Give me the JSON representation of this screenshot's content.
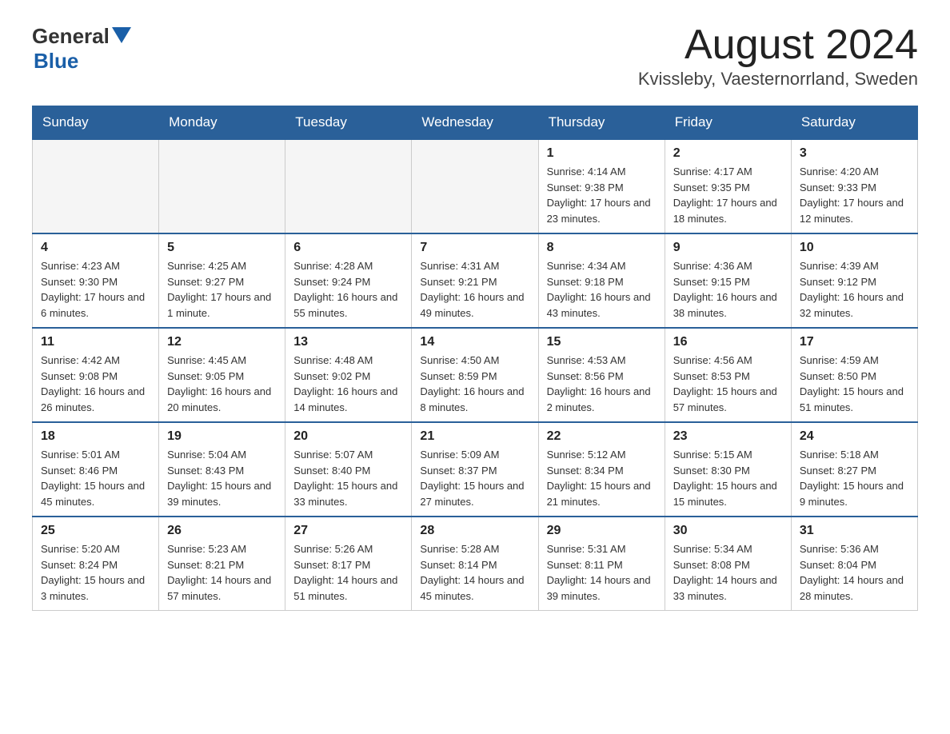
{
  "header": {
    "logo_general": "General",
    "logo_blue": "Blue",
    "month_title": "August 2024",
    "location": "Kvissleby, Vaesternorrland, Sweden"
  },
  "calendar": {
    "days_of_week": [
      "Sunday",
      "Monday",
      "Tuesday",
      "Wednesday",
      "Thursday",
      "Friday",
      "Saturday"
    ],
    "weeks": [
      [
        {
          "day": "",
          "info": ""
        },
        {
          "day": "",
          "info": ""
        },
        {
          "day": "",
          "info": ""
        },
        {
          "day": "",
          "info": ""
        },
        {
          "day": "1",
          "info": "Sunrise: 4:14 AM\nSunset: 9:38 PM\nDaylight: 17 hours and 23 minutes."
        },
        {
          "day": "2",
          "info": "Sunrise: 4:17 AM\nSunset: 9:35 PM\nDaylight: 17 hours and 18 minutes."
        },
        {
          "day": "3",
          "info": "Sunrise: 4:20 AM\nSunset: 9:33 PM\nDaylight: 17 hours and 12 minutes."
        }
      ],
      [
        {
          "day": "4",
          "info": "Sunrise: 4:23 AM\nSunset: 9:30 PM\nDaylight: 17 hours and 6 minutes."
        },
        {
          "day": "5",
          "info": "Sunrise: 4:25 AM\nSunset: 9:27 PM\nDaylight: 17 hours and 1 minute."
        },
        {
          "day": "6",
          "info": "Sunrise: 4:28 AM\nSunset: 9:24 PM\nDaylight: 16 hours and 55 minutes."
        },
        {
          "day": "7",
          "info": "Sunrise: 4:31 AM\nSunset: 9:21 PM\nDaylight: 16 hours and 49 minutes."
        },
        {
          "day": "8",
          "info": "Sunrise: 4:34 AM\nSunset: 9:18 PM\nDaylight: 16 hours and 43 minutes."
        },
        {
          "day": "9",
          "info": "Sunrise: 4:36 AM\nSunset: 9:15 PM\nDaylight: 16 hours and 38 minutes."
        },
        {
          "day": "10",
          "info": "Sunrise: 4:39 AM\nSunset: 9:12 PM\nDaylight: 16 hours and 32 minutes."
        }
      ],
      [
        {
          "day": "11",
          "info": "Sunrise: 4:42 AM\nSunset: 9:08 PM\nDaylight: 16 hours and 26 minutes."
        },
        {
          "day": "12",
          "info": "Sunrise: 4:45 AM\nSunset: 9:05 PM\nDaylight: 16 hours and 20 minutes."
        },
        {
          "day": "13",
          "info": "Sunrise: 4:48 AM\nSunset: 9:02 PM\nDaylight: 16 hours and 14 minutes."
        },
        {
          "day": "14",
          "info": "Sunrise: 4:50 AM\nSunset: 8:59 PM\nDaylight: 16 hours and 8 minutes."
        },
        {
          "day": "15",
          "info": "Sunrise: 4:53 AM\nSunset: 8:56 PM\nDaylight: 16 hours and 2 minutes."
        },
        {
          "day": "16",
          "info": "Sunrise: 4:56 AM\nSunset: 8:53 PM\nDaylight: 15 hours and 57 minutes."
        },
        {
          "day": "17",
          "info": "Sunrise: 4:59 AM\nSunset: 8:50 PM\nDaylight: 15 hours and 51 minutes."
        }
      ],
      [
        {
          "day": "18",
          "info": "Sunrise: 5:01 AM\nSunset: 8:46 PM\nDaylight: 15 hours and 45 minutes."
        },
        {
          "day": "19",
          "info": "Sunrise: 5:04 AM\nSunset: 8:43 PM\nDaylight: 15 hours and 39 minutes."
        },
        {
          "day": "20",
          "info": "Sunrise: 5:07 AM\nSunset: 8:40 PM\nDaylight: 15 hours and 33 minutes."
        },
        {
          "day": "21",
          "info": "Sunrise: 5:09 AM\nSunset: 8:37 PM\nDaylight: 15 hours and 27 minutes."
        },
        {
          "day": "22",
          "info": "Sunrise: 5:12 AM\nSunset: 8:34 PM\nDaylight: 15 hours and 21 minutes."
        },
        {
          "day": "23",
          "info": "Sunrise: 5:15 AM\nSunset: 8:30 PM\nDaylight: 15 hours and 15 minutes."
        },
        {
          "day": "24",
          "info": "Sunrise: 5:18 AM\nSunset: 8:27 PM\nDaylight: 15 hours and 9 minutes."
        }
      ],
      [
        {
          "day": "25",
          "info": "Sunrise: 5:20 AM\nSunset: 8:24 PM\nDaylight: 15 hours and 3 minutes."
        },
        {
          "day": "26",
          "info": "Sunrise: 5:23 AM\nSunset: 8:21 PM\nDaylight: 14 hours and 57 minutes."
        },
        {
          "day": "27",
          "info": "Sunrise: 5:26 AM\nSunset: 8:17 PM\nDaylight: 14 hours and 51 minutes."
        },
        {
          "day": "28",
          "info": "Sunrise: 5:28 AM\nSunset: 8:14 PM\nDaylight: 14 hours and 45 minutes."
        },
        {
          "day": "29",
          "info": "Sunrise: 5:31 AM\nSunset: 8:11 PM\nDaylight: 14 hours and 39 minutes."
        },
        {
          "day": "30",
          "info": "Sunrise: 5:34 AM\nSunset: 8:08 PM\nDaylight: 14 hours and 33 minutes."
        },
        {
          "day": "31",
          "info": "Sunrise: 5:36 AM\nSunset: 8:04 PM\nDaylight: 14 hours and 28 minutes."
        }
      ]
    ]
  }
}
